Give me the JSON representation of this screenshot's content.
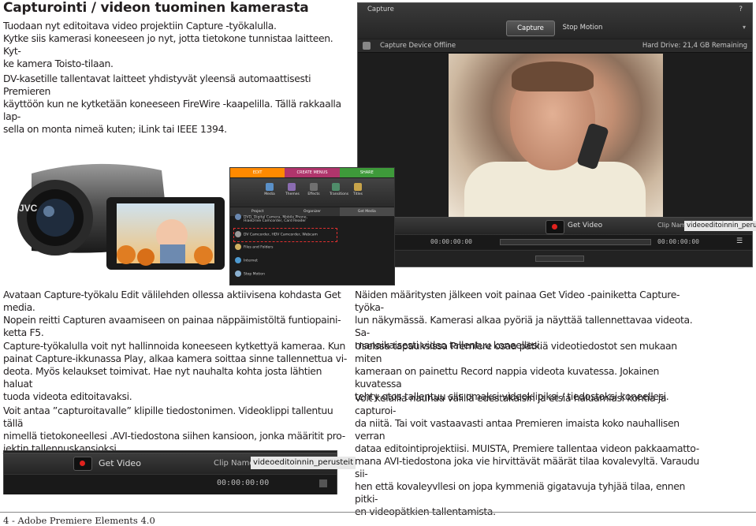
{
  "page": {
    "title": "Capturointi / videon tuominen kamerasta",
    "intro_1": "Tuodaan nyt editoitava video projektiin Capture -työkalulla.",
    "intro_2": "Kytke siis kamerasi koneeseen jo nyt, jotta tietokone tunnistaa laitteen. Kyt-",
    "intro_3": "ke kamera Toisto-tilaan.",
    "dv_1": "DV-kasetille tallentavat laitteet yhdistyvät yleensä automaattisesti Premieren",
    "dv_2": "käyttöön kun ne kytketään koneeseen FireWire -kaapelilla. Tällä rakkaalla lap-",
    "dv_3": "sella on monta nimeä kuten; iLink tai IEEE 1394.",
    "left_p1": [
      "Avataan Capture-työkalu Edit välilehden ollessa aktiivisena kohdasta Get media.",
      "Nopein reitti Capturen avaamiseen on painaa näppäimistöltä funtiopaini-",
      "ketta F5."
    ],
    "left_p2": [
      "Capture-työkalulla voit nyt hallinnoida koneeseen kytkettyä kameraa. Kun",
      "painat Capture-ikkunassa Play, alkaa kamera soittaa sinne tallennettua vi-",
      "deota. Myös kelaukset toimivat. Hae nyt nauhalta kohta josta lähtien haluat",
      "tuoda videota editoitavaksi."
    ],
    "left_p3": [
      "Voit antaa ”capturoitavalle” klipille tiedostonimen. Videoklippi tallentuu tällä",
      "nimellä tietokoneellesi .AVI-tiedostona siihen kansioon, jonka määritit pro-",
      "jektin tallennuskansioksi."
    ],
    "right_p1": [
      "Näiden määritysten jälkeen voit painaa Get Video -painiketta Capture-työka-",
      "lun näkymässä. Kamerasi alkaa pyöriä ja näyttää tallennettavaa videota. Sa-",
      "manaikaisesti video tallentuu koneellesi."
    ],
    "right_p2": [
      "Useissa tapauksissa Premiere osaa pätkiä videotiedostot sen mukaan miten",
      "kameraan on painettu Record nappia videota kuvatessa. Jokainen kuvatessa",
      "tehty otos tallentuu siis omaksi videoklipiksi / tiedostoksi koneellesi."
    ],
    "right_p3": [
      "Voit kelailla nauhaa välillä edestakaisin ja etsia haluamiasi kohtia ja capturoi-",
      "da niitä. Tai voit vastaavasti antaa Premieren imaista koko nauhallisen verran",
      "dataa editointiprojektiisi. MUISTA, Premiere tallentaa videon pakkaamatto-",
      "mana AVI-tiedostona joka vie hirvittävät määrät tilaa kovalevyltä. Varaudu sii-",
      "hen että kovaleyvllesi on jopa kymmeniä gigatavuja tyhjää tilaa, ennen pitki-",
      "en videopätkien tallentamista."
    ],
    "footer": "4 - Adobe Premiere Elements 4.0"
  },
  "capture": {
    "window_title": "Capture",
    "help": "?",
    "tab_capture": "Capture",
    "tab_stop": "Stop Motion",
    "status": "Capture Device Offline",
    "hard_drive": "Hard Drive: 21,4 GB Remaining",
    "get_video": "Get Video",
    "clip_name_label": "Clip Name:",
    "clip_name": "videoeditoinnin_perusteit",
    "timecode_left": "00:00:00:00",
    "timecode_right": "00:00:00:00"
  },
  "organizer": {
    "tab_edit": "EDIT",
    "tab_create": "CREATE MENUS",
    "tab_share": "SHARE",
    "icon_media": "Media",
    "icon_themes": "Themes",
    "icon_effects": "Effects",
    "icon_transitions": "Transitions",
    "icon_titles": "Titles",
    "sub_project": "Project",
    "sub_organizer": "Organizer",
    "sub_getmedia": "Get Media",
    "item_1": "DVD, Digital Camera, Mobile Phone,",
    "item_1b": "HiaeDrive Camcorder, Card Reader",
    "item_2": "DV Camcorder, HDV Camcorder, Webcam",
    "item_3": "Files and Folders",
    "item_4": "Internet",
    "item_5": "Stop Motion",
    "colors": {
      "edit": "#ff8a00",
      "create": "#b0356c",
      "share": "#3e9a3a"
    }
  },
  "strip": {
    "get_video": "Get Video",
    "clip_name_label": "Clip Name:",
    "clip_name": "videoeditoinnin_perusteit",
    "timecode": "00:00:00:00"
  },
  "camcorder": {
    "brand": "JVC"
  }
}
